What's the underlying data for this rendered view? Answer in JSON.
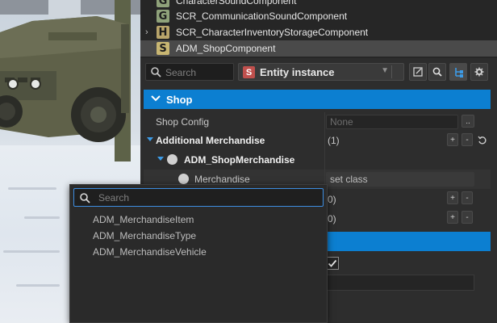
{
  "components": [
    {
      "badge": "G",
      "badge_color": "#8fa27a",
      "label": "CharacterSoundComponent",
      "expandable": false,
      "selected": false
    },
    {
      "badge": "G",
      "badge_color": "#8fa27a",
      "label": "SCR_CommunicationSoundComponent",
      "expandable": false,
      "selected": false
    },
    {
      "badge": "H",
      "badge_color": "#b9a56b",
      "label": "SCR_CharacterInventoryStorageComponent",
      "expandable": true,
      "selected": false
    },
    {
      "badge": "S",
      "badge_color": "#c8b672",
      "label": "ADM_ShopComponent",
      "expandable": false,
      "selected": true
    }
  ],
  "toolbar": {
    "search_placeholder": "Search",
    "entity_label": "Entity instance",
    "entity_icon": "S"
  },
  "section": {
    "title": "Shop",
    "accent": "#0c7fd1"
  },
  "properties": {
    "shop_config": {
      "label": "Shop Config",
      "value": "None",
      "button": ".."
    },
    "additional_merchandise": {
      "label": "Additional Merchandise",
      "value": "(1)",
      "add": "+",
      "remove": "-"
    },
    "adm_shop_merchandise": {
      "label": "ADM_ShopMerchandise"
    },
    "merchandise": {
      "label": "Merchandise",
      "value": "set class"
    },
    "row_a": {
      "value": "0)",
      "add": "+",
      "remove": "-"
    },
    "row_b": {
      "value": "0)",
      "add": "+",
      "remove": "-"
    }
  },
  "popup": {
    "search_placeholder": "Search",
    "options": [
      "ADM_MerchandiseItem",
      "ADM_MerchandiseType",
      "ADM_MerchandiseVehicle"
    ]
  }
}
